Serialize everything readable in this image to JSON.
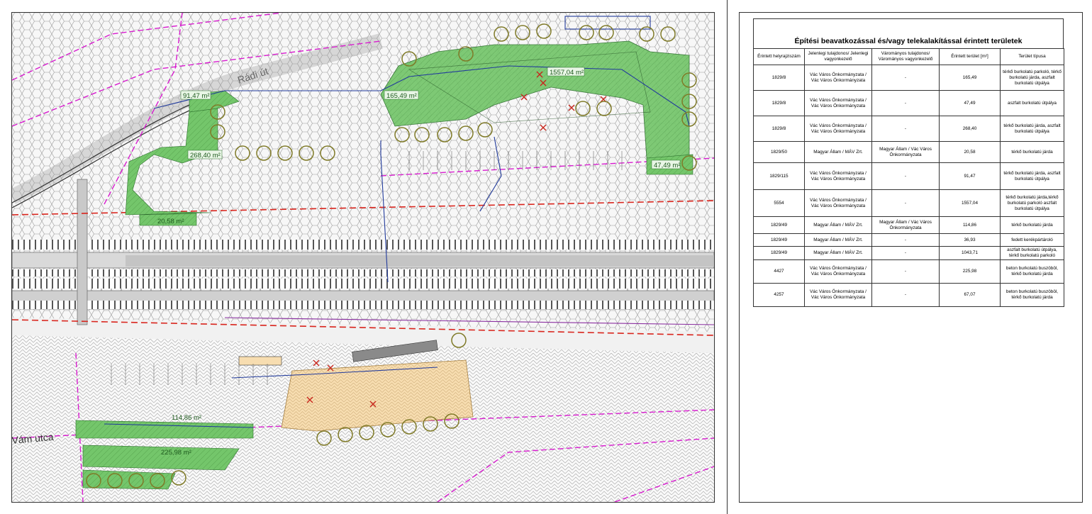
{
  "map": {
    "street_radi": "Rádi út",
    "street_vam": "Vám utca",
    "areas": [
      {
        "id": "a1",
        "label": "91,47 m²"
      },
      {
        "id": "a2",
        "label": "165,49 m²"
      },
      {
        "id": "a3",
        "label": "1557,04 m²"
      },
      {
        "id": "a4",
        "label": "268,40 m²"
      },
      {
        "id": "a5",
        "label": "47,49 m²"
      },
      {
        "id": "a6",
        "label": "20,58 m²"
      },
      {
        "id": "a7",
        "label": "114,86 m²"
      },
      {
        "id": "a8",
        "label": "225,98 m²"
      }
    ],
    "colors": {
      "green": "#74c66b",
      "tan": "#f7ddb0",
      "pink_line": "#d81ccf",
      "red_dash": "#d9251d",
      "tree": "#7f7a28",
      "blue": "#223b9c"
    }
  },
  "table": {
    "title": "Építési beavatkozással és/vagy telekalakítással érintett területek",
    "headers": [
      "Érintett helyrajziszám",
      "Jelenlegi tulajdonos/ Jelenlegi vagyonkezelő",
      "Várományos tulajdonos/ Várományos vagyonkezelő",
      "Érintett terület [m²]",
      "Terület típusa"
    ],
    "rows": [
      [
        "1829/8",
        "Vác Város Önkormányzata / Vác Város Önkormányzata",
        "-",
        "165,49",
        "térkő burkolatú parkoló, térkő burkolatú járda, aszfalt burkolatú útpálya"
      ],
      [
        "1829/8",
        "Vác Város Önkormányzata / Vác Város Önkormányzata",
        "-",
        "47,49",
        "aszfalt burkolatú útpálya"
      ],
      [
        "1829/8",
        "Vác Város Önkormányzata / Vác Város Önkormányzata",
        "-",
        "268,40",
        "térkő burkolatú járda, aszfalt burkolatú útpálya"
      ],
      [
        "1829/50",
        "Magyar Állam / MÁV Zrt.",
        "Magyar Állam / Vác Város Önkormányzata",
        "20,58",
        "térkő burkolatú járda"
      ],
      [
        "1829/115",
        "Vác Város Önkormányzata / Vác Város Önkormányzata",
        "-",
        "91,47",
        "térkő burkolatú járda, aszfalt burkolatú útpálya"
      ],
      [
        "5554",
        "Vác Város Önkormányzata / Vác Város Önkormányzata",
        "-",
        "1557,04",
        "térkő burkolatú járda,térkő burkolatú parkoló aszfalt burkolatú útpálya"
      ],
      [
        "1829/49",
        "Magyar Állam / MÁV Zrt.",
        "Magyar Állam / Vác Város Önkormányzata",
        "114,86",
        "térkő burkolatú járda"
      ],
      [
        "1829/49",
        "Magyar Állam / MÁV Zrt.",
        "-",
        "36,93",
        "fedett kerékpártároló"
      ],
      [
        "1829/49",
        "Magyar Állam / MÁV Zrt.",
        "-",
        "1043,71",
        "aszfalt burkolatú útpálya, térkő burkolatú parkoló"
      ],
      [
        "4427",
        "Vác Város Önkormányzata / Vác Város Önkormányzata",
        "-",
        "225,98",
        "beton burkolatú buszöböl, térkő burkolatú járda"
      ],
      [
        "4257",
        "Vác Város Önkormányzata / Vác Város Önkormányzata",
        "-",
        "67,07",
        "beton burkolatú buszöböl, térkő burkolatú járda"
      ]
    ]
  }
}
